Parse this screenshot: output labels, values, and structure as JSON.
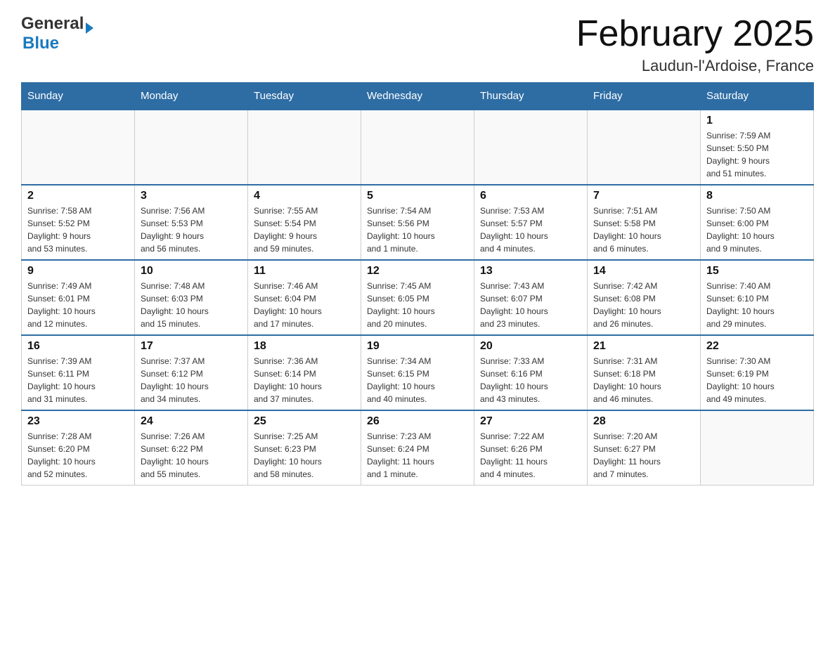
{
  "header": {
    "logo_general": "General",
    "logo_blue": "Blue",
    "title": "February 2025",
    "location": "Laudun-l'Ardoise, France"
  },
  "weekdays": [
    "Sunday",
    "Monday",
    "Tuesday",
    "Wednesday",
    "Thursday",
    "Friday",
    "Saturday"
  ],
  "weeks": [
    [
      {
        "day": "",
        "info": ""
      },
      {
        "day": "",
        "info": ""
      },
      {
        "day": "",
        "info": ""
      },
      {
        "day": "",
        "info": ""
      },
      {
        "day": "",
        "info": ""
      },
      {
        "day": "",
        "info": ""
      },
      {
        "day": "1",
        "info": "Sunrise: 7:59 AM\nSunset: 5:50 PM\nDaylight: 9 hours\nand 51 minutes."
      }
    ],
    [
      {
        "day": "2",
        "info": "Sunrise: 7:58 AM\nSunset: 5:52 PM\nDaylight: 9 hours\nand 53 minutes."
      },
      {
        "day": "3",
        "info": "Sunrise: 7:56 AM\nSunset: 5:53 PM\nDaylight: 9 hours\nand 56 minutes."
      },
      {
        "day": "4",
        "info": "Sunrise: 7:55 AM\nSunset: 5:54 PM\nDaylight: 9 hours\nand 59 minutes."
      },
      {
        "day": "5",
        "info": "Sunrise: 7:54 AM\nSunset: 5:56 PM\nDaylight: 10 hours\nand 1 minute."
      },
      {
        "day": "6",
        "info": "Sunrise: 7:53 AM\nSunset: 5:57 PM\nDaylight: 10 hours\nand 4 minutes."
      },
      {
        "day": "7",
        "info": "Sunrise: 7:51 AM\nSunset: 5:58 PM\nDaylight: 10 hours\nand 6 minutes."
      },
      {
        "day": "8",
        "info": "Sunrise: 7:50 AM\nSunset: 6:00 PM\nDaylight: 10 hours\nand 9 minutes."
      }
    ],
    [
      {
        "day": "9",
        "info": "Sunrise: 7:49 AM\nSunset: 6:01 PM\nDaylight: 10 hours\nand 12 minutes."
      },
      {
        "day": "10",
        "info": "Sunrise: 7:48 AM\nSunset: 6:03 PM\nDaylight: 10 hours\nand 15 minutes."
      },
      {
        "day": "11",
        "info": "Sunrise: 7:46 AM\nSunset: 6:04 PM\nDaylight: 10 hours\nand 17 minutes."
      },
      {
        "day": "12",
        "info": "Sunrise: 7:45 AM\nSunset: 6:05 PM\nDaylight: 10 hours\nand 20 minutes."
      },
      {
        "day": "13",
        "info": "Sunrise: 7:43 AM\nSunset: 6:07 PM\nDaylight: 10 hours\nand 23 minutes."
      },
      {
        "day": "14",
        "info": "Sunrise: 7:42 AM\nSunset: 6:08 PM\nDaylight: 10 hours\nand 26 minutes."
      },
      {
        "day": "15",
        "info": "Sunrise: 7:40 AM\nSunset: 6:10 PM\nDaylight: 10 hours\nand 29 minutes."
      }
    ],
    [
      {
        "day": "16",
        "info": "Sunrise: 7:39 AM\nSunset: 6:11 PM\nDaylight: 10 hours\nand 31 minutes."
      },
      {
        "day": "17",
        "info": "Sunrise: 7:37 AM\nSunset: 6:12 PM\nDaylight: 10 hours\nand 34 minutes."
      },
      {
        "day": "18",
        "info": "Sunrise: 7:36 AM\nSunset: 6:14 PM\nDaylight: 10 hours\nand 37 minutes."
      },
      {
        "day": "19",
        "info": "Sunrise: 7:34 AM\nSunset: 6:15 PM\nDaylight: 10 hours\nand 40 minutes."
      },
      {
        "day": "20",
        "info": "Sunrise: 7:33 AM\nSunset: 6:16 PM\nDaylight: 10 hours\nand 43 minutes."
      },
      {
        "day": "21",
        "info": "Sunrise: 7:31 AM\nSunset: 6:18 PM\nDaylight: 10 hours\nand 46 minutes."
      },
      {
        "day": "22",
        "info": "Sunrise: 7:30 AM\nSunset: 6:19 PM\nDaylight: 10 hours\nand 49 minutes."
      }
    ],
    [
      {
        "day": "23",
        "info": "Sunrise: 7:28 AM\nSunset: 6:20 PM\nDaylight: 10 hours\nand 52 minutes."
      },
      {
        "day": "24",
        "info": "Sunrise: 7:26 AM\nSunset: 6:22 PM\nDaylight: 10 hours\nand 55 minutes."
      },
      {
        "day": "25",
        "info": "Sunrise: 7:25 AM\nSunset: 6:23 PM\nDaylight: 10 hours\nand 58 minutes."
      },
      {
        "day": "26",
        "info": "Sunrise: 7:23 AM\nSunset: 6:24 PM\nDaylight: 11 hours\nand 1 minute."
      },
      {
        "day": "27",
        "info": "Sunrise: 7:22 AM\nSunset: 6:26 PM\nDaylight: 11 hours\nand 4 minutes."
      },
      {
        "day": "28",
        "info": "Sunrise: 7:20 AM\nSunset: 6:27 PM\nDaylight: 11 hours\nand 7 minutes."
      },
      {
        "day": "",
        "info": ""
      }
    ]
  ]
}
